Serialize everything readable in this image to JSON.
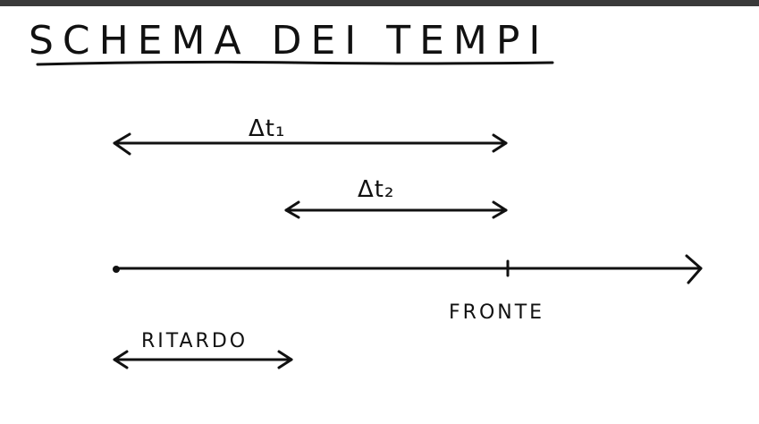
{
  "title": "SCHEMA DEI TEMPI",
  "labels": {
    "dt1": "Δt₁",
    "dt2": "Δt₂",
    "fronte": "FRONTE",
    "ritardo": "RITARDO"
  },
  "colors": {
    "ink": "#111111",
    "background": "#ffffff",
    "topbar": "#3a3a3a"
  }
}
